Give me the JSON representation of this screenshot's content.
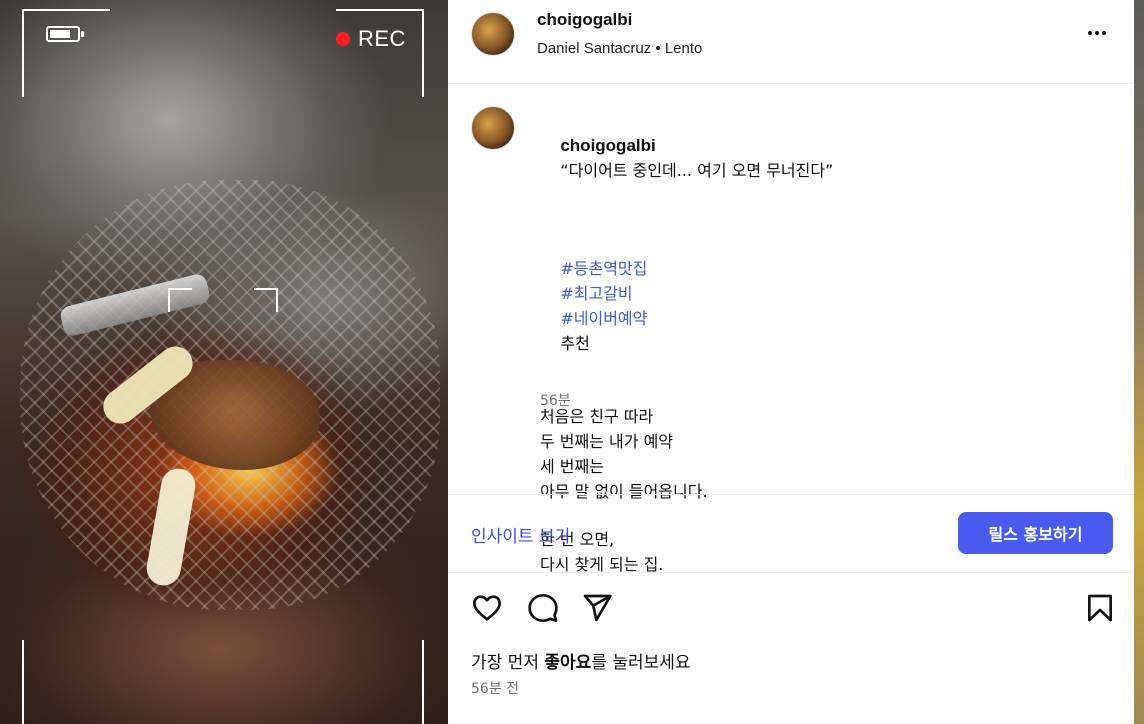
{
  "media": {
    "rec_label": "REC",
    "battery_level": 0.8,
    "rec_color": "#ff1c1c"
  },
  "header": {
    "username": "choigogalbi",
    "audio_artist": "Daniel Santacruz",
    "separator": "•",
    "audio_title": "Lento",
    "more_icon": "more-horizontal-icon"
  },
  "caption": {
    "username": "choigogalbi",
    "quote": "“다이어트 중인데... 여기 오면 무너진다”",
    "hashtags": [
      "#등촌역맛집",
      "#최고갈비",
      "#네이버예약"
    ],
    "hashtag_suffix": "추천",
    "paragraph1": [
      "처음은 친구 따라",
      "두 번째는 내가 예약",
      "세 번째는",
      "아무 말 없이 들어옵니다."
    ],
    "paragraph2": [
      "한 번 오면,",
      "다시 찾게 되는 집."
    ],
    "time": "56분"
  },
  "insights": {
    "view_label": "인사이트 보기",
    "promote_label": "릴스 홍보하기",
    "accent": "#4a5cf0"
  },
  "actions": {
    "like_icon": "heart-icon",
    "comment_icon": "comment-icon",
    "share_icon": "send-icon",
    "save_icon": "bookmark-icon"
  },
  "likes": {
    "prefix": "가장 먼저 ",
    "bold": "좋아요",
    "suffix": "를 눌러보세요"
  },
  "post_time": "56분 전"
}
